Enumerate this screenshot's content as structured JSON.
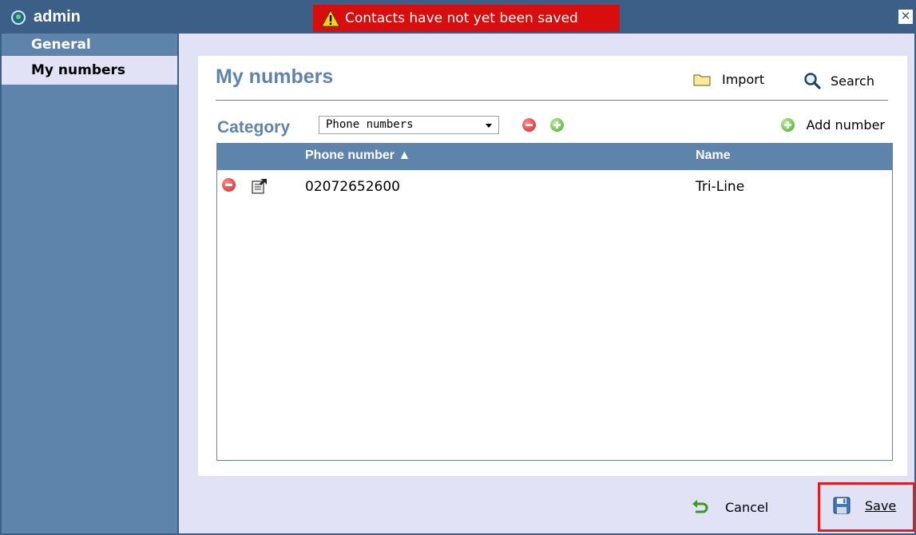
{
  "window": {
    "title": "admin",
    "banner": "Contacts have not yet been saved",
    "close_glyph": "✕"
  },
  "sidebar": {
    "items": [
      {
        "label": "General"
      },
      {
        "label": "My numbers"
      }
    ]
  },
  "panel": {
    "title": "My numbers",
    "import_label": "Import",
    "search_label": "Search",
    "category_label": "Category",
    "category_value": "Phone numbers",
    "add_number_label": "Add number"
  },
  "table": {
    "headers": {
      "phone": "Phone number ▲",
      "name": "Name"
    },
    "rows": [
      {
        "phone": "02072652600",
        "name": "Tri-Line"
      }
    ]
  },
  "footer": {
    "cancel_label": "Cancel",
    "save_label": "Save"
  },
  "colors": {
    "titlebar": "#3b5f86",
    "sidebar": "#5e84ab",
    "banner": "#d80d0d",
    "accent": "#5e84ab",
    "save_highlight": "#e21b1b"
  },
  "icons": {
    "app": "globe-icon",
    "warning": "warning-icon",
    "close": "close-icon",
    "import": "folder-icon",
    "search": "magnifier-icon",
    "delete": "minus-circle-icon",
    "add": "plus-circle-icon",
    "properties": "properties-icon",
    "cancel": "undo-arrow-icon",
    "save": "floppy-disk-icon"
  }
}
